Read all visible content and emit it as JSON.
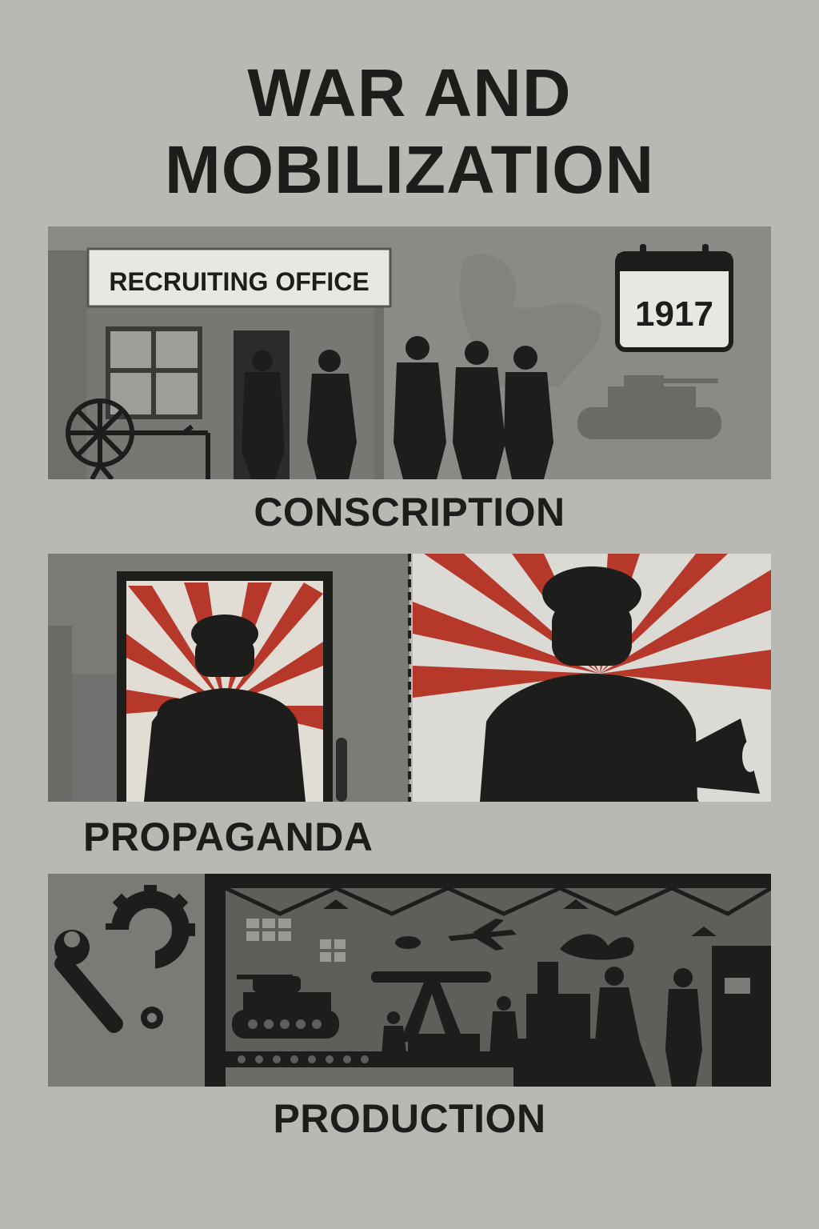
{
  "title": "WAR AND MOBILIZATION",
  "colors": {
    "background": "#b9b8b2",
    "ink": "#1d1d1b",
    "accent_red": "#b5382a",
    "panel_gray": "#7a7a76"
  },
  "sections": {
    "conscription": {
      "caption": "CONSCRIPTION",
      "sign": "RECRUITING OFFICE",
      "calendar_year": "1917",
      "icons": [
        "spinning-wheel-icon",
        "calendar-icon",
        "tank-icon"
      ]
    },
    "propaganda": {
      "caption": "PROPAGANDA",
      "icons": [
        "megaphone-icon"
      ]
    },
    "production": {
      "caption": "PRODUCTION",
      "icons": [
        "wrench-icon",
        "gear-icon",
        "tank-icon",
        "plane-icon"
      ]
    }
  }
}
